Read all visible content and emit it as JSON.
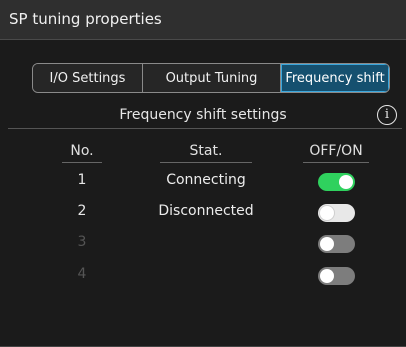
{
  "window": {
    "title": "SP tuning properties"
  },
  "tabs": [
    {
      "label": "I/O Settings",
      "active": false
    },
    {
      "label": "Output Tuning",
      "active": false
    },
    {
      "label": "Frequency shift",
      "active": true
    }
  ],
  "section": {
    "title": "Frequency shift settings",
    "info_icon": "info-icon",
    "info_glyph": "i"
  },
  "table": {
    "headers": {
      "no": "No.",
      "stat": "Stat.",
      "onoff": "OFF/ON"
    },
    "rows": [
      {
        "no": "1",
        "stat": "Connecting",
        "toggle": "on",
        "enabled": true
      },
      {
        "no": "2",
        "stat": "Disconnected",
        "toggle": "off",
        "enabled": true
      },
      {
        "no": "3",
        "stat": "",
        "toggle": "off",
        "enabled": false
      },
      {
        "no": "4",
        "stat": "",
        "toggle": "off",
        "enabled": false
      }
    ]
  },
  "colors": {
    "background": "#1b1b1b",
    "active_tab": "#15506f",
    "toggle_on": "#2fd15e",
    "toggle_off": "#e8e8e8",
    "toggle_disabled": "#7d7d7d"
  }
}
